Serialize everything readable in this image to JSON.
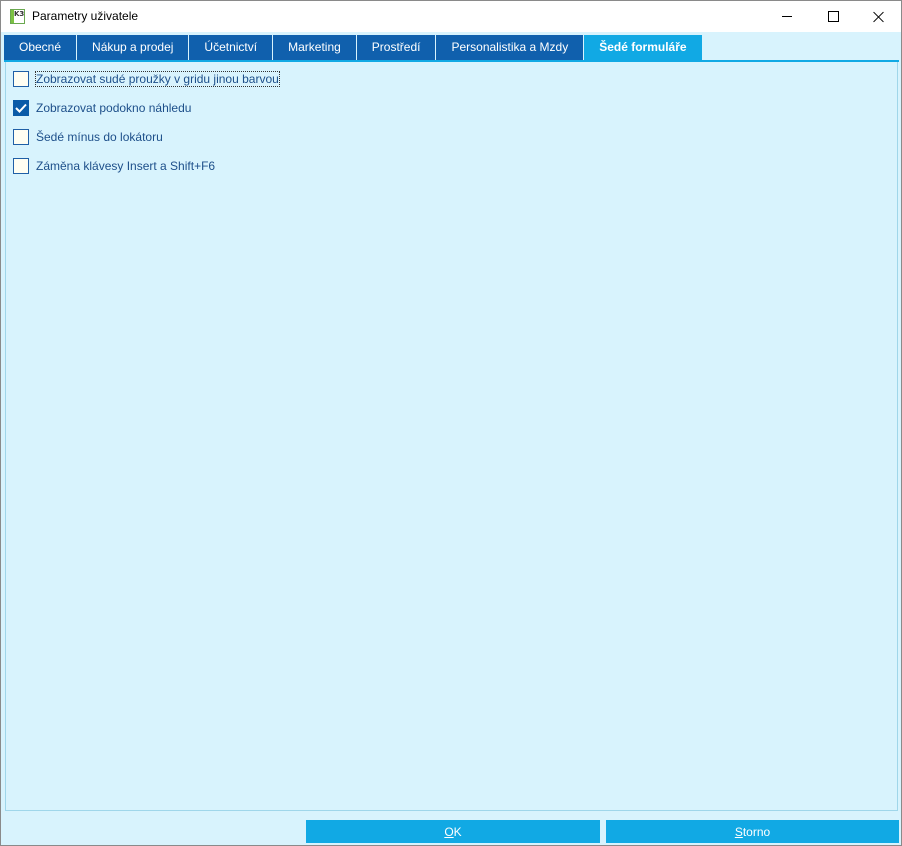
{
  "window": {
    "title": "Parametry uživatele",
    "icon": "k3-app-icon"
  },
  "tabs": [
    {
      "label": "Obecné",
      "active": false
    },
    {
      "label": "Nákup a prodej",
      "active": false
    },
    {
      "label": "Účetnictví",
      "active": false
    },
    {
      "label": "Marketing",
      "active": false
    },
    {
      "label": "Prostředí",
      "active": false
    },
    {
      "label": "Personalistika a Mzdy",
      "active": false
    },
    {
      "label": "Šedé formuláře",
      "active": true
    }
  ],
  "options": [
    {
      "label": "Zobrazovat sudé proužky v gridu jinou barvou",
      "checked": false,
      "focused": true
    },
    {
      "label": "Zobrazovat podokno náhledu",
      "checked": true,
      "focused": false
    },
    {
      "label": "Šedé mínus do lokátoru",
      "checked": false,
      "focused": false
    },
    {
      "label": "Záměna klávesy Insert a Shift+F6",
      "checked": false,
      "focused": false
    }
  ],
  "buttons": {
    "ok": {
      "accel": "O",
      "rest": "K"
    },
    "storno": {
      "accel": "S",
      "rest": "torno"
    }
  },
  "colors": {
    "tab": "#1060ad",
    "tab_active": "#11a9e4",
    "panel_bg": "#d8f3fd",
    "button": "#11a9e4",
    "checkbox_checked": "#0a5ba8"
  }
}
